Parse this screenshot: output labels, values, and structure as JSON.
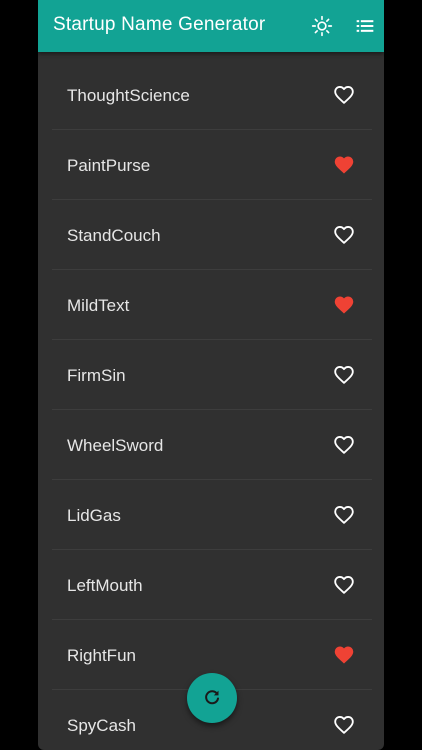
{
  "appbar": {
    "title": "Startup Name Generator",
    "theme_icon": "brightness-icon",
    "saved_icon": "list-icon"
  },
  "colors": {
    "accent": "#12a394",
    "background": "#303030",
    "favorite": "#ef4234",
    "heart_outline": "#ffffff"
  },
  "names": [
    {
      "label": "ThoughtScience",
      "saved": false
    },
    {
      "label": "PaintPurse",
      "saved": true
    },
    {
      "label": "StandCouch",
      "saved": false
    },
    {
      "label": "MildText",
      "saved": true
    },
    {
      "label": "FirmSin",
      "saved": false
    },
    {
      "label": "WheelSword",
      "saved": false
    },
    {
      "label": "LidGas",
      "saved": false
    },
    {
      "label": "LeftMouth",
      "saved": false
    },
    {
      "label": "RightFun",
      "saved": true
    },
    {
      "label": "SpyCash",
      "saved": false
    }
  ],
  "fab": {
    "icon": "refresh-icon"
  }
}
